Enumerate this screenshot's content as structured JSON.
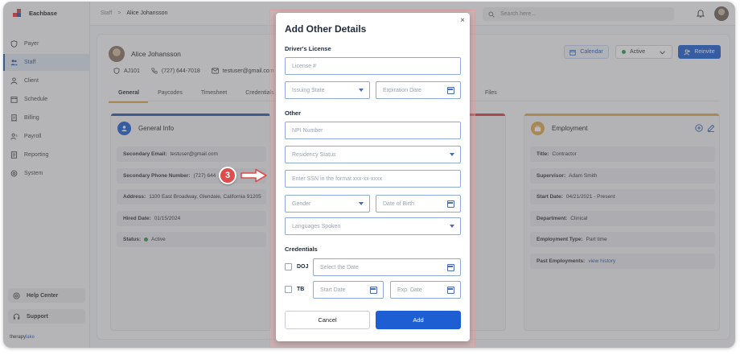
{
  "app": {
    "name": "Eachbase",
    "footer_logo_a": "therapy",
    "footer_logo_b": "lake"
  },
  "colors": {
    "primary": "#1d5fd3",
    "annotation": "#e04b4b",
    "active_status": "#2e9a4b"
  },
  "sidebar": {
    "items": [
      {
        "label": "Payer",
        "icon": "shield-icon"
      },
      {
        "label": "Staff",
        "icon": "users-icon",
        "active": true
      },
      {
        "label": "Client",
        "icon": "user-icon"
      },
      {
        "label": "Schedule",
        "icon": "calendar-icon"
      },
      {
        "label": "Billing",
        "icon": "receipt-icon"
      },
      {
        "label": "Payroll",
        "icon": "payroll-icon"
      },
      {
        "label": "Reporting",
        "icon": "report-icon"
      },
      {
        "label": "System",
        "icon": "gear-icon"
      }
    ],
    "help_center": "Help Center",
    "support": "Support"
  },
  "topbar": {
    "breadcrumb_root": "Staff",
    "breadcrumb_sep": ">",
    "breadcrumb_current": "Alice Johansson",
    "search_placeholder": "Search here..."
  },
  "profile": {
    "name": "Alice Johansson",
    "id": "AJ101",
    "phone": "(727) 644-7018",
    "email": "testuser@gmail.com",
    "calendar_label": "Calendar",
    "status_value": "Active",
    "reinvite_label": "Reinvite"
  },
  "tabs": [
    "General",
    "Paycodes",
    "Timesheet",
    "Credentials"
  ],
  "tab_files": "Files",
  "general_info": {
    "title": "General Info",
    "rows": [
      {
        "label": "Secondary Email:",
        "value": "testuser@gmail.com"
      },
      {
        "label": "Secondary Phone Number:",
        "value": "(727) 644"
      },
      {
        "label": "Address:",
        "value": "1100 East Broadway, Glendale, California 91205"
      },
      {
        "label": "Hired Date:",
        "value": "01/15/2024"
      },
      {
        "label": "Status:",
        "value": "Active"
      }
    ]
  },
  "employment": {
    "title": "Employment",
    "rows": [
      {
        "label": "Title:",
        "value": "Contractor"
      },
      {
        "label": "Supervisor:",
        "value": "Adam Smith"
      },
      {
        "label": "Start Date:",
        "value": "04/21/2021 - Present"
      },
      {
        "label": "Department:",
        "value": "Clinical"
      },
      {
        "label": "Employment Type:",
        "value": "Part time"
      },
      {
        "label": "Past Employments:",
        "value": "view history"
      }
    ]
  },
  "modal": {
    "title": "Add Other Details",
    "close": "×",
    "drivers_license_label": "Driver's License",
    "license_placeholder": "License #",
    "issuing_state_placeholder": "Issuing State",
    "expiration_placeholder": "Expiration Date",
    "other_label": "Other",
    "npi_placeholder": "NPI Number",
    "residency_placeholder": "Residency Status",
    "ssn_placeholder": "Enter SSN in the format xxx-xx-xxxx",
    "gender_placeholder": "Gender",
    "dob_placeholder": "Date of Birth",
    "languages_placeholder": "Languages Spoken",
    "credentials_label": "Credentials",
    "doj_label": "DOJ",
    "doj_date_placeholder": "Select the Date",
    "tb_label": "TB",
    "tb_start_placeholder": "Start Date",
    "tb_exp_placeholder": "Exp. Date",
    "cancel_label": "Cancel",
    "add_label": "Add"
  },
  "annotation": {
    "step": "3"
  }
}
